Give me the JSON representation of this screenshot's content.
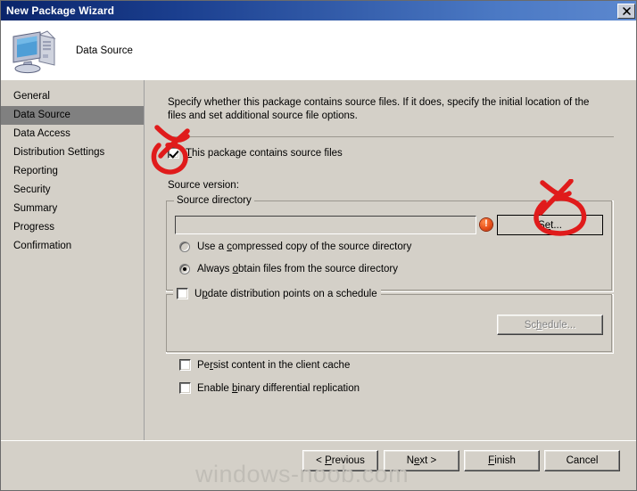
{
  "window": {
    "title": "New Package Wizard",
    "close_label": "✕"
  },
  "header": {
    "title": "Data Source",
    "icon": "computer-icon"
  },
  "sidebar": {
    "items": [
      {
        "label": "General",
        "selected": false
      },
      {
        "label": "Data Source",
        "selected": true
      },
      {
        "label": "Data Access",
        "selected": false
      },
      {
        "label": "Distribution Settings",
        "selected": false
      },
      {
        "label": "Reporting",
        "selected": false
      },
      {
        "label": "Security",
        "selected": false
      },
      {
        "label": "Summary",
        "selected": false
      },
      {
        "label": "Progress",
        "selected": false
      },
      {
        "label": "Confirmation",
        "selected": false
      }
    ]
  },
  "main": {
    "description": "Specify whether this package contains source files. If it does, specify the initial location of the files and set additional source file options.",
    "contains_source_files": {
      "label_pre": "T",
      "label_rest": "his package contains source files",
      "checked": true
    },
    "source_version_label": "Source version:",
    "source_directory_group": {
      "legend": "Source directory",
      "path_value": "",
      "path_placeholder": "",
      "error_icon": "error-exclamation-icon",
      "set_button": {
        "label_pre": "S",
        "label_accel": "e",
        "label_rest": "t..."
      },
      "set_button_label": "Set...",
      "radios": [
        {
          "label_pre": "Use a ",
          "label_accel": "c",
          "label_rest": "ompressed copy of the source directory",
          "selected": false
        },
        {
          "label_pre": "Always ",
          "label_accel": "o",
          "label_rest": "btain files from the source directory",
          "selected": true
        }
      ]
    },
    "update_schedule_group": {
      "checkbox": {
        "label_pre": "U",
        "label_accel": "p",
        "label_rest": "date distribution points on a schedule",
        "checked": false
      },
      "schedule_button": {
        "label_pre": "Sc",
        "label_accel": "h",
        "label_rest": "edule...",
        "disabled": true
      },
      "schedule_button_label": "Schedule..."
    },
    "persist_cache": {
      "label_pre": "Pe",
      "label_accel": "r",
      "label_rest": "sist content in the client cache",
      "checked": false
    },
    "binary_delta": {
      "label_pre": "Enable ",
      "label_accel": "b",
      "label_rest": "inary differential replication",
      "checked": false
    }
  },
  "footer": {
    "previous": {
      "label_pre": "< ",
      "label_accel": "P",
      "label_rest": "revious"
    },
    "next": {
      "label_pre": "N",
      "label_accel": "e",
      "label_rest": "xt >"
    },
    "finish": {
      "label_pre": "",
      "label_accel": "F",
      "label_rest": "inish"
    },
    "cancel": {
      "label_pre": "Cancel",
      "label_accel": "",
      "label_rest": ""
    }
  },
  "watermark": {
    "text": "windows-noob.com"
  },
  "annotations": {
    "color": "#e01b1b",
    "marks": [
      {
        "name": "circle-x-over-source-files-checkbox",
        "target": "contains-source-files-checkbox"
      },
      {
        "name": "circle-x-over-set-button",
        "target": "set-button"
      }
    ]
  }
}
